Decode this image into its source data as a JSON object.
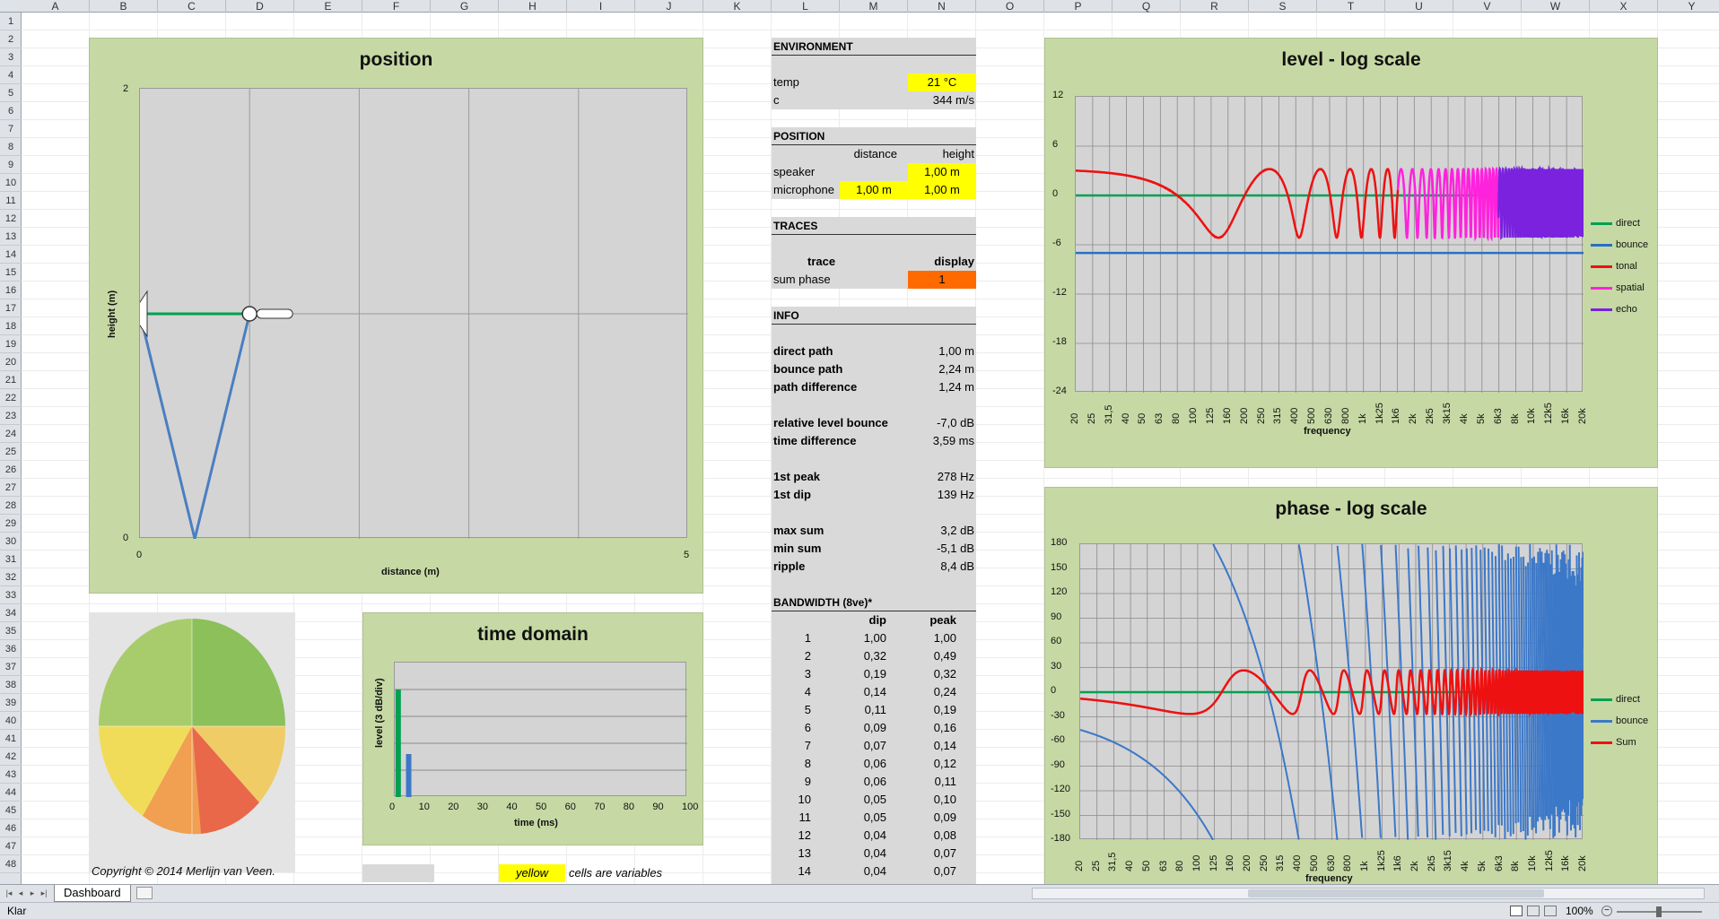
{
  "columns": [
    "A",
    "B",
    "C",
    "D",
    "E",
    "F",
    "G",
    "H",
    "I",
    "J",
    "K",
    "L",
    "M",
    "N",
    "O",
    "P",
    "Q",
    "R",
    "S",
    "T",
    "U",
    "V",
    "W",
    "X",
    "Y"
  ],
  "rows": [
    "1",
    "2",
    "3",
    "4",
    "5",
    "6",
    "7",
    "8",
    "9",
    "10",
    "11",
    "12",
    "13",
    "14",
    "15",
    "16",
    "17",
    "18",
    "19",
    "20",
    "21",
    "22",
    "23",
    "24",
    "25",
    "26",
    "27",
    "28",
    "29",
    "30",
    "31",
    "32",
    "33",
    "34",
    "35",
    "36",
    "37",
    "38",
    "39",
    "40",
    "41",
    "42",
    "43",
    "44",
    "45",
    "46",
    "47",
    "48"
  ],
  "position_chart": {
    "title": "position",
    "xlabel": "distance (m)",
    "ylabel": "height (m)",
    "x_ticks": [
      "0",
      "5"
    ],
    "y_ticks": [
      "2",
      "0"
    ],
    "speaker": {
      "x": 0,
      "y": 1.0
    },
    "microphone": {
      "x": 1.0,
      "y": 1.0
    }
  },
  "time_domain": {
    "title": "time domain",
    "xlabel": "time (ms)",
    "ylabel": "level (3 dB/div)",
    "x_ticks": [
      "0",
      "10",
      "20",
      "30",
      "40",
      "50",
      "60",
      "70",
      "80",
      "90",
      "100"
    ],
    "colors": {
      "direct": "#00a050",
      "bounce": "#3c78c8"
    }
  },
  "copyright": "Copyright © 2014 Merlijn van Veen.",
  "legend_note": {
    "yellow": "yellow",
    "rest": "cells are variables"
  },
  "environment": {
    "header": "ENVIRONMENT",
    "temp_label": "temp",
    "temp_value": "21 °C",
    "c_label": "c",
    "c_value": "344 m/s"
  },
  "position_table": {
    "header": "POSITION",
    "col_distance": "distance",
    "col_height": "height",
    "speaker_label": "speaker",
    "speaker_height": "1,00 m",
    "mic_label": "microphone",
    "mic_distance": "1,00 m",
    "mic_height": "1,00 m"
  },
  "traces": {
    "header": "TRACES",
    "col_trace": "trace",
    "col_display": "display",
    "trace_name": "sum phase",
    "display_value": "1"
  },
  "info": {
    "header": "INFO",
    "rows": [
      {
        "k": "direct path",
        "v": "1,00 m"
      },
      {
        "k": "bounce path",
        "v": "2,24 m"
      },
      {
        "k": "path difference",
        "v": "1,24 m"
      },
      {
        "k": "relative level bounce",
        "v": "-7,0 dB"
      },
      {
        "k": "time difference",
        "v": "3,59 ms"
      },
      {
        "k": "1st peak",
        "v": "278 Hz"
      },
      {
        "k": "1st dip",
        "v": "139 Hz"
      },
      {
        "k": "max sum",
        "v": "3,2 dB"
      },
      {
        "k": "min sum",
        "v": "-5,1 dB"
      },
      {
        "k": "ripple",
        "v": "8,4 dB"
      }
    ]
  },
  "bandwidth": {
    "header": "BANDWIDTH (8ve)*",
    "col_dip": "dip",
    "col_peak": "peak",
    "rows": [
      [
        "1",
        "1,00",
        "1,00"
      ],
      [
        "2",
        "0,32",
        "0,49"
      ],
      [
        "3",
        "0,19",
        "0,32"
      ],
      [
        "4",
        "0,14",
        "0,24"
      ],
      [
        "5",
        "0,11",
        "0,19"
      ],
      [
        "6",
        "0,09",
        "0,16"
      ],
      [
        "7",
        "0,07",
        "0,14"
      ],
      [
        "8",
        "0,06",
        "0,12"
      ],
      [
        "9",
        "0,06",
        "0,11"
      ],
      [
        "10",
        "0,05",
        "0,10"
      ],
      [
        "11",
        "0,05",
        "0,09"
      ],
      [
        "12",
        "0,04",
        "0,08"
      ],
      [
        "13",
        "0,04",
        "0,07"
      ],
      [
        "14",
        "0,04",
        "0,07"
      ]
    ]
  },
  "freq_ticks": [
    "20",
    "25",
    "31,5",
    "40",
    "50",
    "63",
    "80",
    "100",
    "125",
    "160",
    "200",
    "250",
    "315",
    "400",
    "500",
    "630",
    "800",
    "1k",
    "1k25",
    "1k6",
    "2k",
    "2k5",
    "3k15",
    "4k",
    "5k",
    "6k3",
    "8k",
    "10k",
    "12k5",
    "16k",
    "20k"
  ],
  "level_chart": {
    "title": "level - log scale",
    "xlabel": "frequency",
    "y_ticks": [
      "12",
      "6",
      "0",
      "-6",
      "-12",
      "-18",
      "-24"
    ],
    "legend": [
      {
        "name": "direct",
        "color": "#00a050"
      },
      {
        "name": "bounce",
        "color": "#2a70c0"
      },
      {
        "name": "tonal",
        "color": "#ee1111"
      },
      {
        "name": "spatial",
        "color": "#ff22dd"
      },
      {
        "name": "echo",
        "color": "#7a22dd"
      }
    ]
  },
  "phase_chart": {
    "title": "phase - log scale",
    "xlabel": "frequency",
    "y_ticks": [
      "180",
      "150",
      "120",
      "90",
      "60",
      "30",
      "0",
      "-30",
      "-60",
      "-90",
      "-120",
      "-150",
      "-180"
    ],
    "legend": [
      {
        "name": "direct",
        "color": "#00a050"
      },
      {
        "name": "bounce",
        "color": "#3c78c8"
      },
      {
        "name": "Sum",
        "color": "#ee1111"
      }
    ]
  },
  "sheet_tab": "Dashboard",
  "status": {
    "ready": "Klar",
    "zoom": "100%"
  }
}
